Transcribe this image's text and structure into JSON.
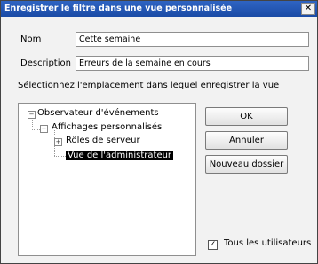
{
  "window": {
    "title": "Enregistrer le filtre dans une vue personnalisée",
    "close_glyph": "✕"
  },
  "form": {
    "name_label": "Nom",
    "name_value": "Cette semaine",
    "description_label": "Description",
    "description_value": "Erreurs de la semaine en cours",
    "location_prompt": "Sélectionnez l'emplacement dans lequel enregistrer la vue"
  },
  "tree": {
    "root": {
      "label": "Observateur d'événements",
      "expander": "−"
    },
    "custom_views": {
      "label": "Affichages personnalisés",
      "expander": "−"
    },
    "server_roles": {
      "label": "Rôles de serveur",
      "expander": "+"
    },
    "admin_view": {
      "label": "Vue de l'administrateur"
    }
  },
  "buttons": {
    "ok": "OK",
    "cancel": "Annuler",
    "new_folder": "Nouveau dossier"
  },
  "all_users": {
    "label": "Tous les utilisateurs",
    "checked": true,
    "check_glyph": "✓"
  }
}
